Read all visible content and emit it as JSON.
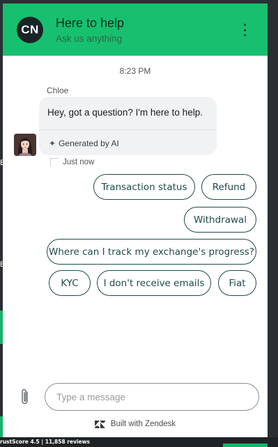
{
  "header": {
    "avatar_initials": "CN",
    "title": "Here to help",
    "subtitle": "Ask us anything",
    "menu_icon": "kebab-menu-icon",
    "color": "#17c06f"
  },
  "conversation": {
    "timestamp": "8:23 PM",
    "sender": "Chloe",
    "message": "Hey, got a question? I'm here to help.",
    "ai_label": "Generated by AI",
    "ai_icon": "sparkle-icon",
    "status": "Just now"
  },
  "quick_replies": [
    "Transaction status",
    "Refund",
    "Withdrawal",
    "Where can I track my exchange's progress?",
    "KYC",
    "I don't receive emails",
    "Fiat"
  ],
  "composer": {
    "placeholder": "Type a message",
    "attach_icon": "paperclip-icon"
  },
  "footer": {
    "built_with": "Built with Zendesk",
    "brand_icon": "zendesk-icon"
  },
  "background_page": {
    "trust_text": "rustScore 4.5 | 11,858 reviews",
    "fragment_e": "E"
  },
  "colors": {
    "chip_border": "#1f4a48",
    "accent_green": "#15b46b"
  }
}
